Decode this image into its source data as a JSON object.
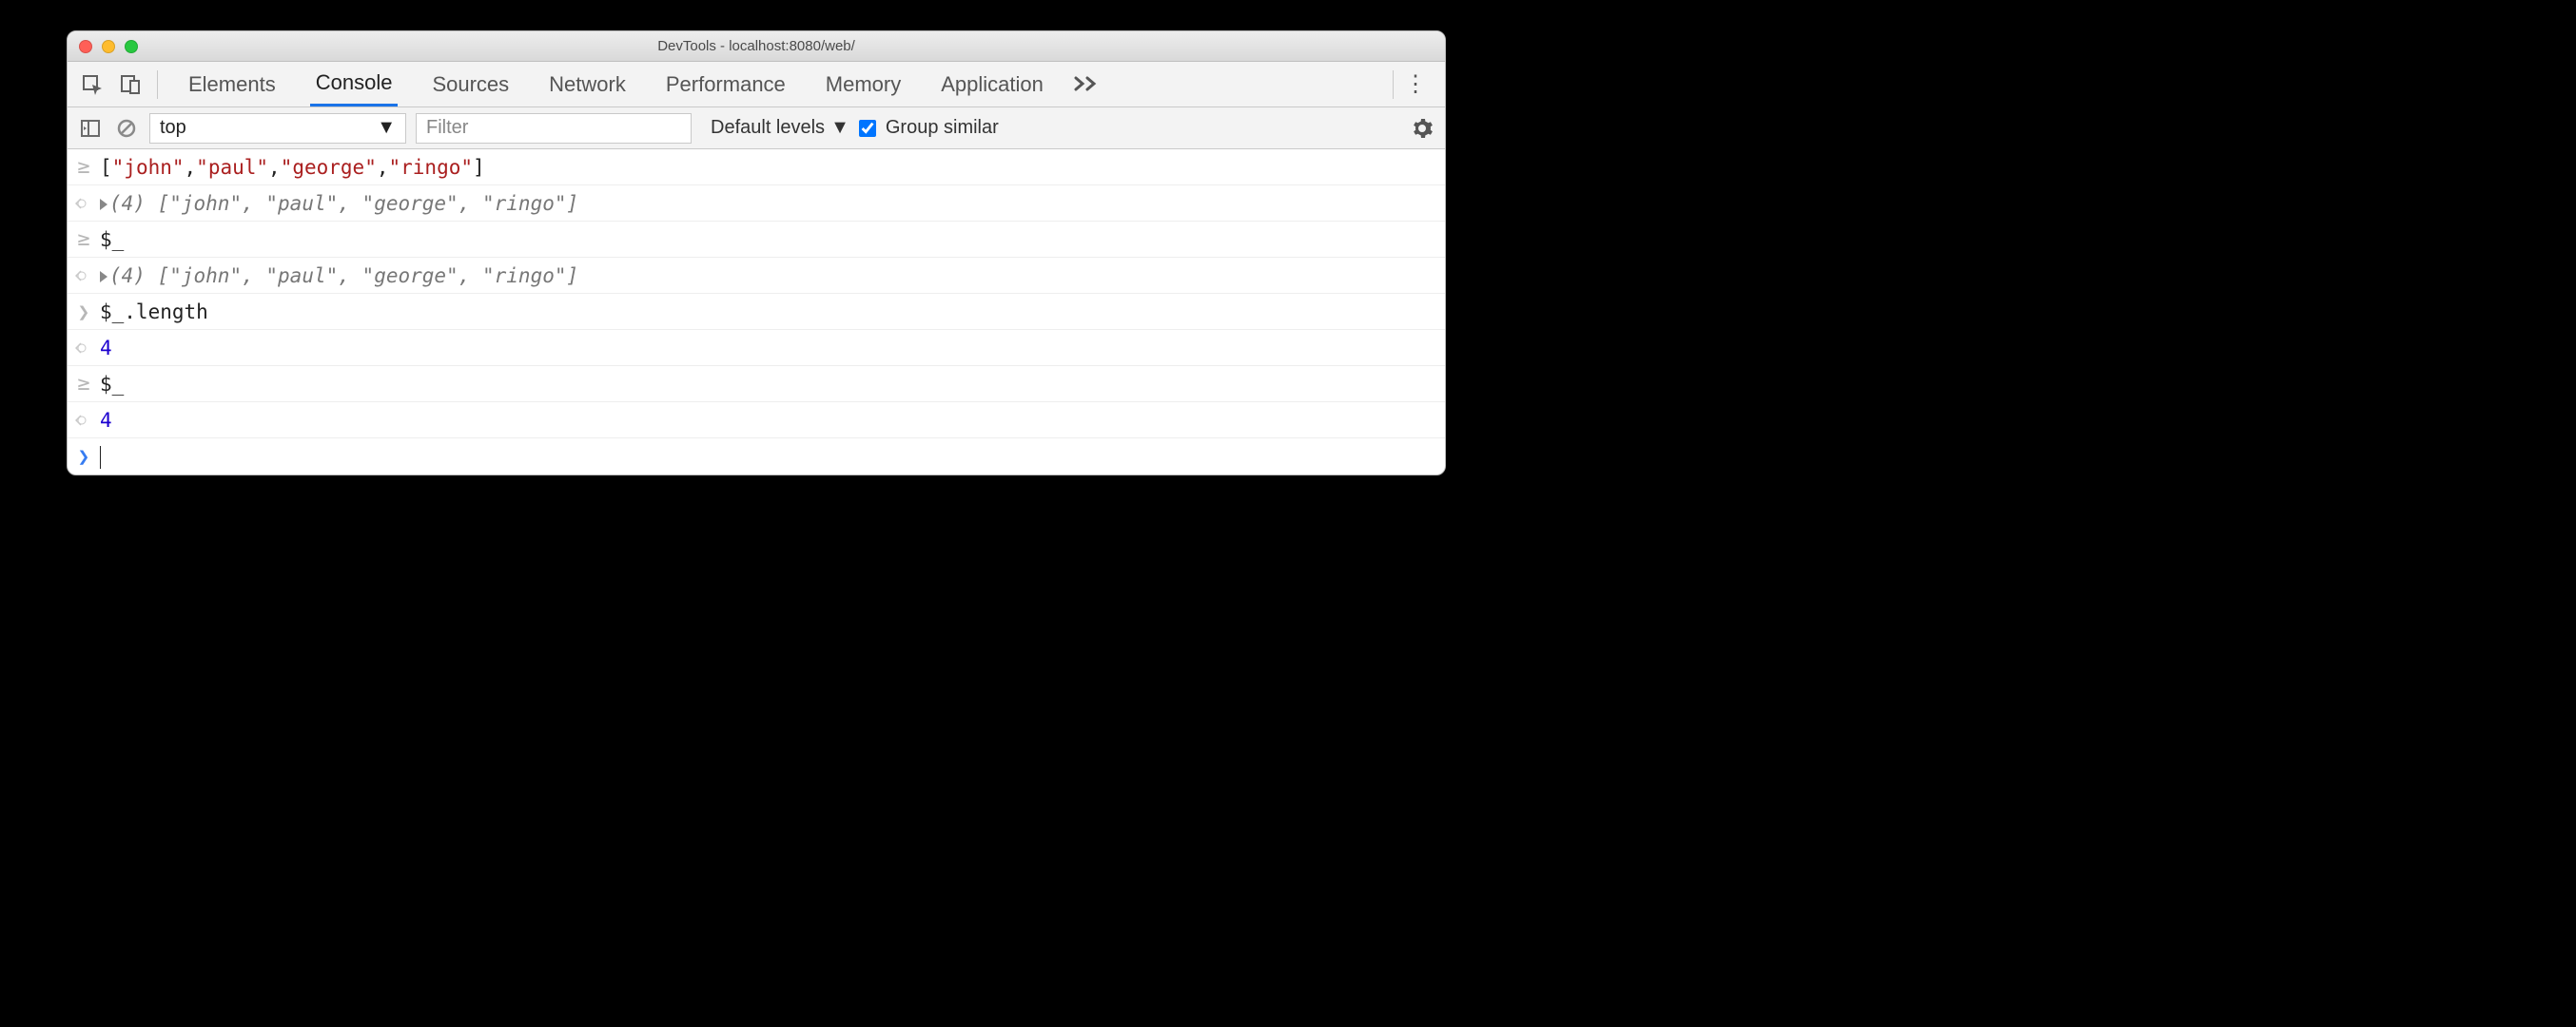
{
  "window": {
    "title": "DevTools - localhost:8080/web/"
  },
  "tabs": {
    "items": [
      "Elements",
      "Console",
      "Sources",
      "Network",
      "Performance",
      "Memory",
      "Application"
    ],
    "active": "Console"
  },
  "filterbar": {
    "context": "top",
    "filter_placeholder": "Filter",
    "levels_label": "Default levels",
    "group_similar_label": "Group similar",
    "group_similar_checked": true
  },
  "console_lines": [
    {
      "kind": "input-eager",
      "segments": [
        {
          "t": "[",
          "c": "plain"
        },
        {
          "t": "\"john\"",
          "c": "darkred"
        },
        {
          "t": ",",
          "c": "plain"
        },
        {
          "t": "\"paul\"",
          "c": "darkred"
        },
        {
          "t": ",",
          "c": "plain"
        },
        {
          "t": "\"george\"",
          "c": "darkred"
        },
        {
          "t": ",",
          "c": "plain"
        },
        {
          "t": "\"ringo\"",
          "c": "darkred"
        },
        {
          "t": "]",
          "c": "plain"
        }
      ]
    },
    {
      "kind": "output-obj",
      "expand": true,
      "prefix": "(4) ",
      "segments": [
        {
          "t": "[",
          "c": "italic"
        },
        {
          "t": "\"john\"",
          "c": "str"
        },
        {
          "t": ", ",
          "c": "italic"
        },
        {
          "t": "\"paul\"",
          "c": "str"
        },
        {
          "t": ", ",
          "c": "italic"
        },
        {
          "t": "\"george\"",
          "c": "str"
        },
        {
          "t": ", ",
          "c": "italic"
        },
        {
          "t": "\"ringo\"",
          "c": "str"
        },
        {
          "t": "]",
          "c": "italic"
        }
      ]
    },
    {
      "kind": "input-eager",
      "segments": [
        {
          "t": "$_",
          "c": "plain"
        }
      ]
    },
    {
      "kind": "output-obj",
      "expand": true,
      "prefix": "(4) ",
      "segments": [
        {
          "t": "[",
          "c": "italic"
        },
        {
          "t": "\"john\"",
          "c": "str"
        },
        {
          "t": ", ",
          "c": "italic"
        },
        {
          "t": "\"paul\"",
          "c": "str"
        },
        {
          "t": ", ",
          "c": "italic"
        },
        {
          "t": "\"george\"",
          "c": "str"
        },
        {
          "t": ", ",
          "c": "italic"
        },
        {
          "t": "\"ringo\"",
          "c": "str"
        },
        {
          "t": "]",
          "c": "italic"
        }
      ]
    },
    {
      "kind": "input",
      "segments": [
        {
          "t": "$_.length",
          "c": "plain"
        }
      ]
    },
    {
      "kind": "output",
      "segments": [
        {
          "t": "4",
          "c": "num"
        }
      ]
    },
    {
      "kind": "input-eager",
      "segments": [
        {
          "t": "$_",
          "c": "plain"
        }
      ]
    },
    {
      "kind": "output",
      "segments": [
        {
          "t": "4",
          "c": "num"
        }
      ]
    },
    {
      "kind": "prompt"
    }
  ]
}
